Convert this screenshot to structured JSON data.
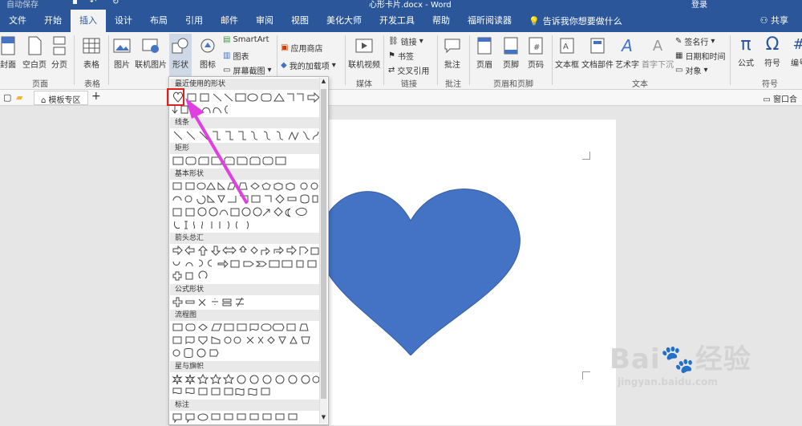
{
  "window": {
    "title_left": "自动保存",
    "title_center": "心形卡片.docx - Word",
    "title_right": "登录"
  },
  "menu": {
    "items": [
      "文件",
      "开始",
      "插入",
      "设计",
      "布局",
      "引用",
      "邮件",
      "审阅",
      "视图",
      "美化大师",
      "开发工具",
      "帮助",
      "福昕阅读器"
    ],
    "tell_me": "告诉我你想要做什么",
    "share": "共享"
  },
  "ribbon": {
    "pages": {
      "cover": "封面",
      "blank": "空白页",
      "break": "分页",
      "group": "页面"
    },
    "tables": {
      "table": "表格",
      "group": "表格"
    },
    "illustrations": {
      "picture": "图片",
      "online_picture": "联机图片",
      "shapes": "形状",
      "icons": "图标",
      "smartart": "SmartArt",
      "chart": "图表",
      "screenshot": "屏幕截图"
    },
    "addins": {
      "store": "应用商店",
      "my_addins": "我的加载项"
    },
    "media": {
      "online_video": "联机视频",
      "group": "媒体"
    },
    "links": {
      "link": "链接",
      "bookmark": "书签",
      "cross_ref": "交叉引用",
      "group": "链接"
    },
    "comments": {
      "comment": "批注",
      "group": "批注"
    },
    "header_footer": {
      "header": "页眉",
      "footer": "页脚",
      "page_number": "页码",
      "group": "页眉和页脚"
    },
    "text": {
      "textbox": "文本框",
      "quickparts": "文档部件",
      "wordart": "艺术字",
      "dropcap": "首字下沉",
      "signature": "签名行",
      "datetime": "日期和时间",
      "object": "对象",
      "group": "文本"
    },
    "symbols": {
      "equation": "公式",
      "symbol": "符号",
      "number": "编号",
      "group": "符号"
    }
  },
  "tabstrip": {
    "tab_label": "模板专区",
    "right": "窗口合"
  },
  "shapes_panel": {
    "sections": [
      "最近使用的形状",
      "线条",
      "矩形",
      "基本形状",
      "箭头总汇",
      "公式形状",
      "流程图",
      "星与旗帜",
      "标注"
    ]
  },
  "colors": {
    "accent": "#2b579a",
    "heart": "#4472c4",
    "arrow": "#e040e0",
    "highlight": "#e0201b"
  },
  "watermark": {
    "brand": "Bai",
    "brand2": "经验",
    "url": "jingyan.baidu.com"
  }
}
